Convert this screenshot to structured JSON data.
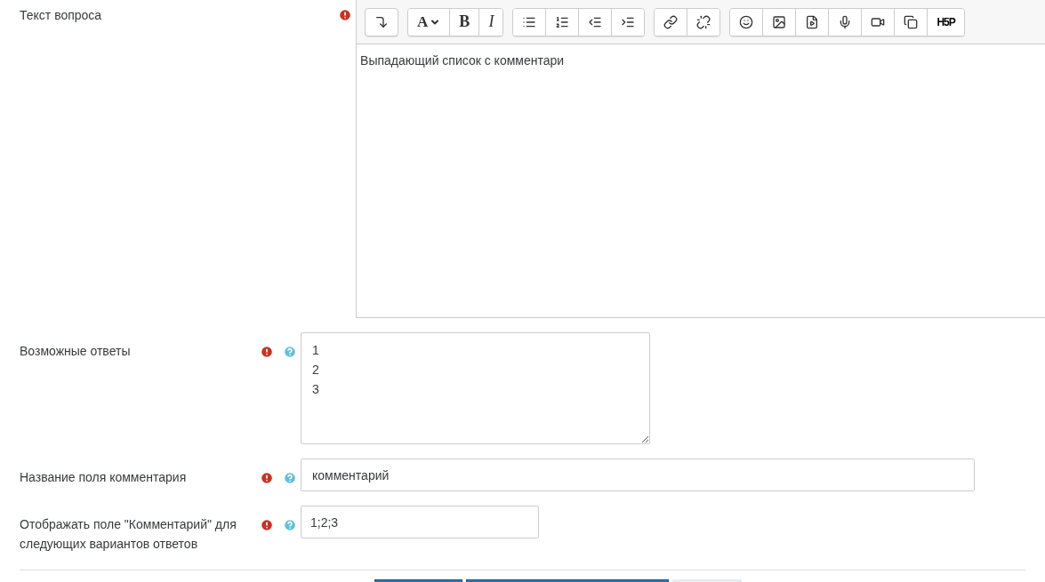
{
  "toolbar": {
    "font": "A",
    "bold": "B",
    "italic": "I",
    "h5p": "H5P"
  },
  "editor": {
    "label": "Текст вопроса",
    "required": true,
    "value": "Выпадающий список с комментари"
  },
  "fields": [
    {
      "label": "Возможные ответы",
      "required": true,
      "help": true,
      "kind": "textarea",
      "value": "1\n2\n3"
    },
    {
      "label": "Название поля комментария",
      "required": true,
      "help": true,
      "kind": "wide",
      "value": "комментарий"
    },
    {
      "label": "Отображать поле \"Комментарий\" для следующих вариантов ответов",
      "required": true,
      "help": true,
      "kind": "short",
      "value": "1;2;3"
    }
  ]
}
